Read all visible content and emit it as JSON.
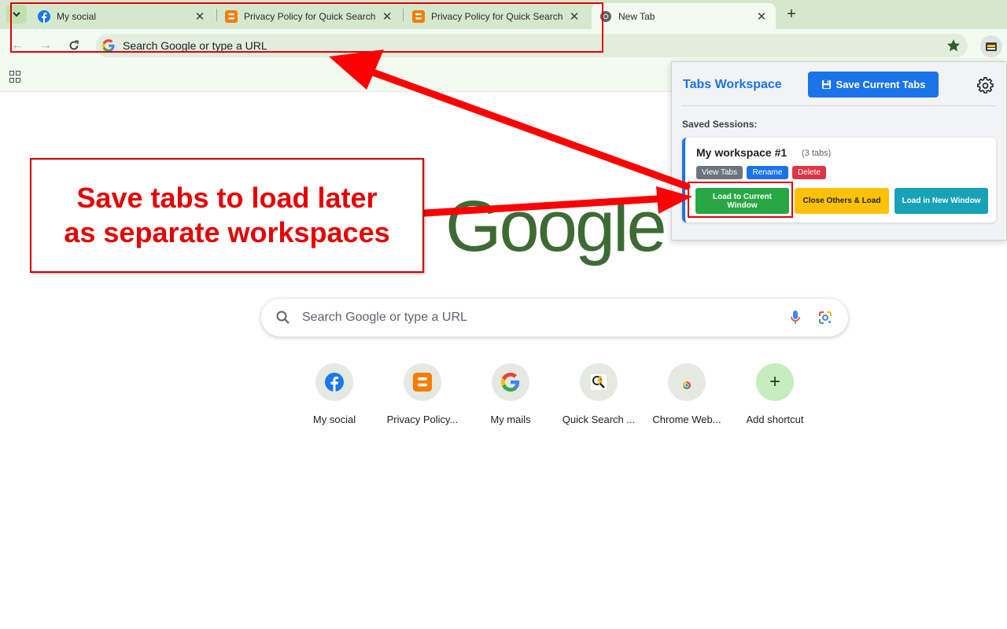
{
  "browser": {
    "tabs": [
      {
        "title": "My social",
        "favicon": "facebook-icon",
        "active": false
      },
      {
        "title": "Privacy Policy for Quick Search",
        "favicon": "blogger-icon",
        "active": false
      },
      {
        "title": "Privacy Policy for Quick Search",
        "favicon": "blogger-icon",
        "active": false
      },
      {
        "title": "New Tab",
        "favicon": "chrome-icon",
        "active": true
      }
    ],
    "omnibox": {
      "placeholder": "Search Google or type a URL"
    }
  },
  "ntp": {
    "logo_text": "Google",
    "search_placeholder": "Search Google or type a URL",
    "shortcuts": [
      {
        "label": "My social",
        "icon": "facebook-icon"
      },
      {
        "label": "Privacy Policy...",
        "icon": "blogger-icon"
      },
      {
        "label": "My mails",
        "icon": "google-icon"
      },
      {
        "label": "Quick Search ...",
        "icon": "quick-search-icon"
      },
      {
        "label": "Chrome Web...",
        "icon": "chrome-web-store-icon"
      },
      {
        "label": "Add shortcut",
        "icon": "plus-icon"
      }
    ]
  },
  "popup": {
    "title": "Tabs Workspace",
    "save_label": "Save Current Tabs",
    "saved_sessions_label": "Saved Sessions:",
    "sessions": [
      {
        "name": "My workspace #1",
        "count": "(3 tabs)",
        "view_label": "View Tabs",
        "rename_label": "Rename",
        "delete_label": "Delete",
        "load_current_label": "Load to Current Window",
        "close_others_label": "Close Others & Load",
        "load_new_label": "Load in New Window"
      }
    ]
  },
  "annotation": {
    "callout_text": "Save tabs to load later\nas separate workspaces"
  },
  "colors": {
    "accent_blue": "#1a73e8",
    "green": "#28a745",
    "yellow": "#ffc107",
    "teal": "#17a2b8",
    "red": "#dc3545",
    "gray": "#6c757d",
    "annotation_red": "#e60000"
  }
}
